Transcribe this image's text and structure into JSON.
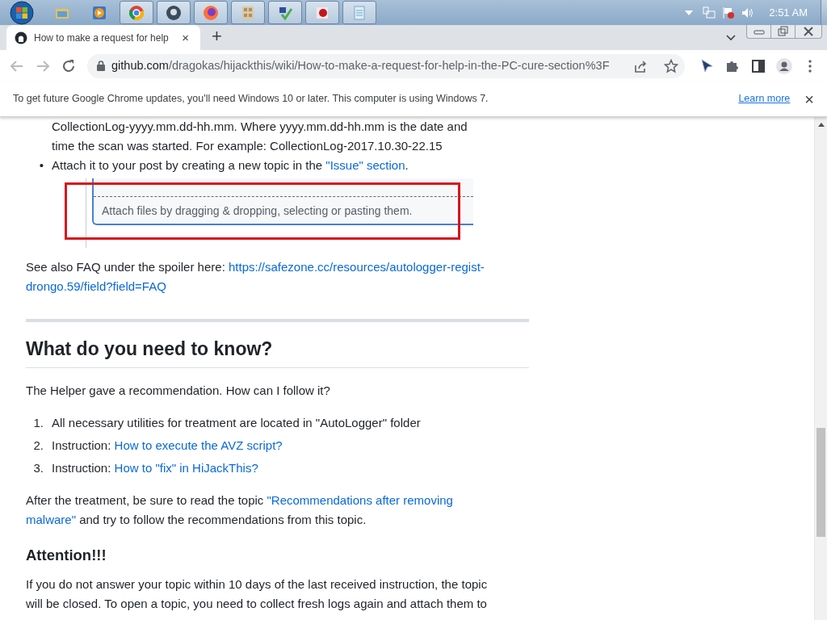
{
  "taskbar": {
    "clock": "2:51 AM"
  },
  "tabs": [
    {
      "title": "How to make a request for help",
      "close": "×",
      "selected": true
    }
  ],
  "new_tab": "+",
  "address_bar": {
    "url": "github.com/dragokas/hijackthis/wiki/How-to-make-a-request-for-help-in-the-PC-cure-section%3F"
  },
  "info_bar": {
    "message": "To get future Google Chrome updates, you'll need Windows 10 or later. This computer is using Windows 7.",
    "link": "Learn more",
    "close": "×"
  },
  "article": [
    {
      "kind": "bullet",
      "lines": [
        [
          {
            "text": "CollectionLog-yyyy.mm.dd-hh.mm. Where yyyy.mm.dd-hh.mm is the date and",
            "link": false
          }
        ],
        [
          {
            "text": "time the scan was started. For example: CollectionLog-2017.10.30-22.15",
            "link": false
          }
        ]
      ]
    },
    {
      "kind": "bullet",
      "marker": "•",
      "lines": [
        [
          {
            "text": "Attach it to your post by creating a new topic in the ",
            "link": false
          },
          {
            "text": "\"Issue\" section",
            "link": true
          },
          {
            "text": ".",
            "link": false
          }
        ]
      ]
    },
    {
      "kind": "screenshot",
      "hint": "Attach files by dragging & dropping, selecting or pasting them."
    },
    {
      "kind": "paragraph",
      "lines": [
        [
          {
            "text": "See also FAQ under the spoiler here: ",
            "link": false
          },
          {
            "text": "https://safezone.cc/resources/autologger-regist-",
            "link": true
          }
        ],
        [
          {
            "text": "drongo.59/field?field=FAQ",
            "link": true
          }
        ]
      ]
    },
    {
      "kind": "rule"
    },
    {
      "kind": "heading",
      "text": "What do you need to know?"
    },
    {
      "kind": "paragraph",
      "lines": [
        [
          {
            "text": "The Helper gave a recommendation. How can I follow it?",
            "link": false
          }
        ]
      ]
    },
    {
      "kind": "numbered",
      "items": [
        {
          "number": "1.",
          "lines": [
            [
              {
                "text": "All necessary utilities for treatment are located in \"AutoLogger\" folder",
                "link": false
              }
            ]
          ]
        },
        {
          "number": "2.",
          "lines": [
            [
              {
                "text": "Instruction: ",
                "link": false
              },
              {
                "text": "How to execute the AVZ script?",
                "link": true
              }
            ]
          ]
        },
        {
          "number": "3.",
          "lines": [
            [
              {
                "text": "Instruction: ",
                "link": false
              },
              {
                "text": "How to \"fix\" in HiJackThis?",
                "link": true
              }
            ]
          ]
        }
      ]
    },
    {
      "kind": "paragraph",
      "lines": [
        [
          {
            "text": "After the treatment, be sure to read the topic ",
            "link": false
          },
          {
            "text": "\"Recommendations after removing",
            "link": true
          }
        ],
        [
          {
            "text": "malware\"",
            "link": true
          },
          {
            "text": " and try to follow the recommendations from this topic.",
            "link": false
          }
        ]
      ]
    },
    {
      "kind": "subheading",
      "text": "Attention!!!"
    },
    {
      "kind": "paragraph",
      "lines": [
        [
          {
            "text": "If you do not answer your topic within 10 days of the last received instruction, the topic",
            "link": false
          }
        ],
        [
          {
            "text": "will be closed. To open a topic, you need to collect fresh logs again and attach them to",
            "link": false
          }
        ]
      ]
    }
  ]
}
